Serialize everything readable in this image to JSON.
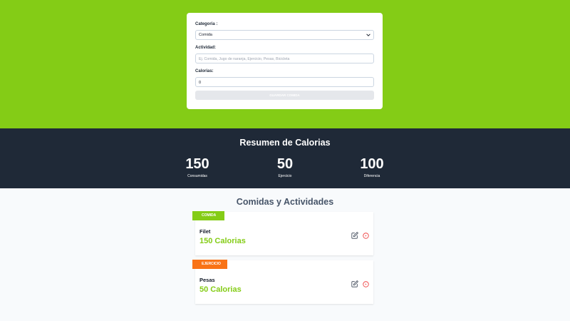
{
  "form": {
    "category_label": "Categoria :",
    "category_value": "Comida",
    "activity_label": "Actividad:",
    "activity_placeholder": "Ej. Comida, Jugo de naranja, Ejercicio, Pesas, Bicicleta",
    "calories_label": "Calorias:",
    "calories_value": "0",
    "submit_label": "Guardar Comida"
  },
  "summary": {
    "title": "Resumen de Calorias",
    "stats": [
      {
        "value": "150",
        "label": "Consumidas"
      },
      {
        "value": "50",
        "label": "Ejercicio"
      },
      {
        "value": "100",
        "label": "Diferencia"
      }
    ]
  },
  "list": {
    "title": "Comidas y Actividades",
    "items": [
      {
        "category": "Comida",
        "name": "Filet",
        "calories": "150 Calorias"
      },
      {
        "category": "Ejercicio",
        "name": "Pesas",
        "calories": "50 Calorias"
      }
    ]
  },
  "colors": {
    "brand_green": "#84cc16",
    "exercise_orange": "#f97316",
    "dark_band": "#1f2937",
    "delete_red": "#ef4444"
  },
  "icons": {
    "edit": "edit-icon",
    "delete": "circle-x-icon",
    "select_arrow": "chevron-down-icon"
  }
}
